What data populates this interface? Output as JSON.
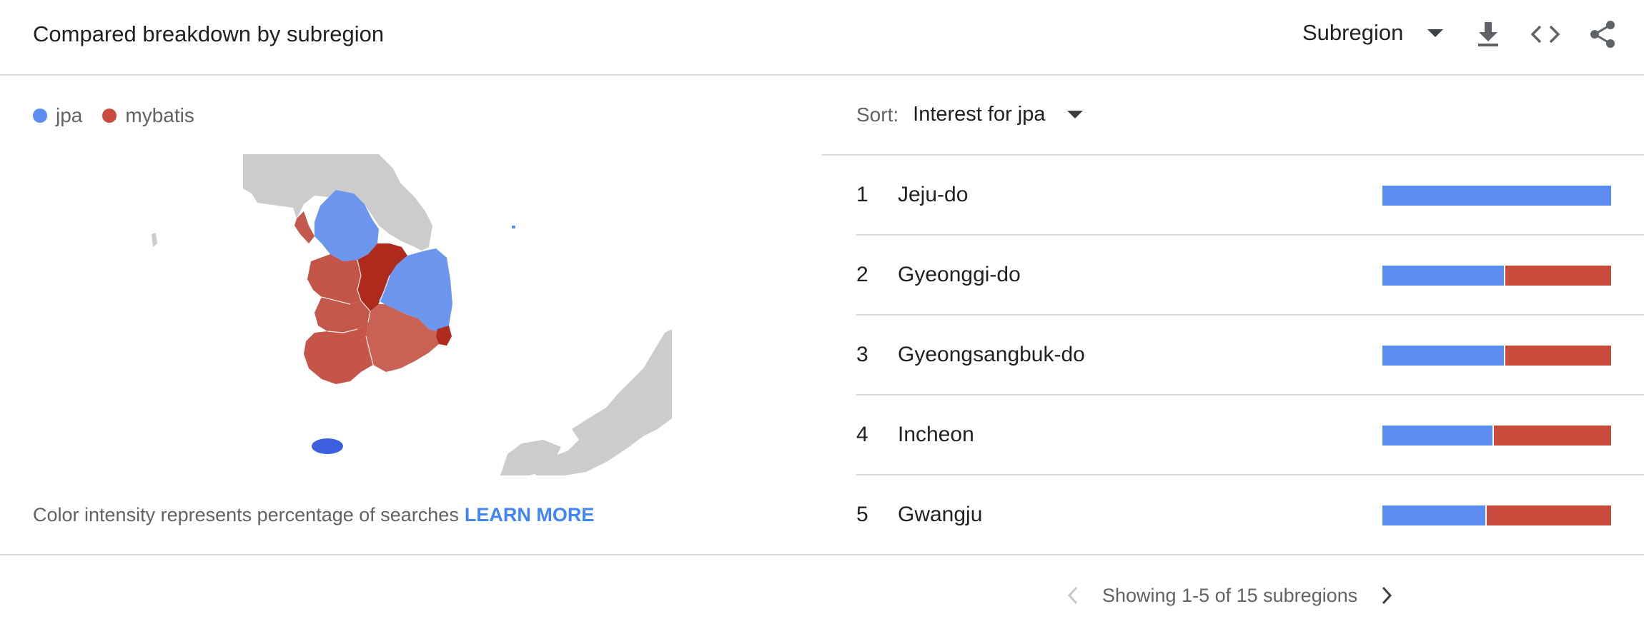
{
  "header": {
    "title": "Compared breakdown by subregion",
    "resolution_label": "Subregion",
    "icons": [
      "download-icon",
      "embed-code-icon",
      "share-icon"
    ]
  },
  "legend": [
    {
      "label": "jpa",
      "color": "#5b8def"
    },
    {
      "label": "mybatis",
      "color": "#c94c3d"
    }
  ],
  "map": {
    "regions": [
      {
        "name": "Jeju-do",
        "color": "#3b5fe0"
      },
      {
        "name": "Gyeonggi-do",
        "color": "#6c95ee"
      },
      {
        "name": "Gyeongsangbuk-do",
        "color": "#6c95ee"
      },
      {
        "name": "Incheon",
        "color": "#c2594c"
      },
      {
        "name": "Chungcheongbuk-do",
        "color": "#ad2a1c"
      },
      {
        "name": "Chungcheongnam-do",
        "color": "#c25547"
      },
      {
        "name": "Jeollabuk-do",
        "color": "#c2574a"
      },
      {
        "name": "Jeollanam-do",
        "color": "#c55548"
      },
      {
        "name": "Gyeongsangnam-do",
        "color": "#c86254"
      },
      {
        "name": "Busan",
        "color": "#b02a1d"
      }
    ],
    "land_color": "#cccccc"
  },
  "footnote": {
    "text": "Color intensity represents percentage of searches",
    "link": "LEARN MORE"
  },
  "sort": {
    "label": "Sort:",
    "value": "Interest for jpa"
  },
  "rows": [
    {
      "rank": "1",
      "name": "Jeju-do",
      "jpa": 1.0,
      "mybatis": 0.0
    },
    {
      "rank": "2",
      "name": "Gyeonggi-do",
      "jpa": 0.53,
      "mybatis": 0.47
    },
    {
      "rank": "3",
      "name": "Gyeongsangbuk-do",
      "jpa": 0.53,
      "mybatis": 0.47
    },
    {
      "rank": "4",
      "name": "Incheon",
      "jpa": 0.48,
      "mybatis": 0.52
    },
    {
      "rank": "5",
      "name": "Gwangju",
      "jpa": 0.45,
      "mybatis": 0.55
    }
  ],
  "pagination": {
    "text": "Showing 1-5 of 15 subregions",
    "prev_enabled": false,
    "next_enabled": true
  },
  "colors": {
    "jpa": "#5b8def",
    "mybatis": "#c94c3d",
    "divider": "#dadce0",
    "link": "#4285f4"
  }
}
